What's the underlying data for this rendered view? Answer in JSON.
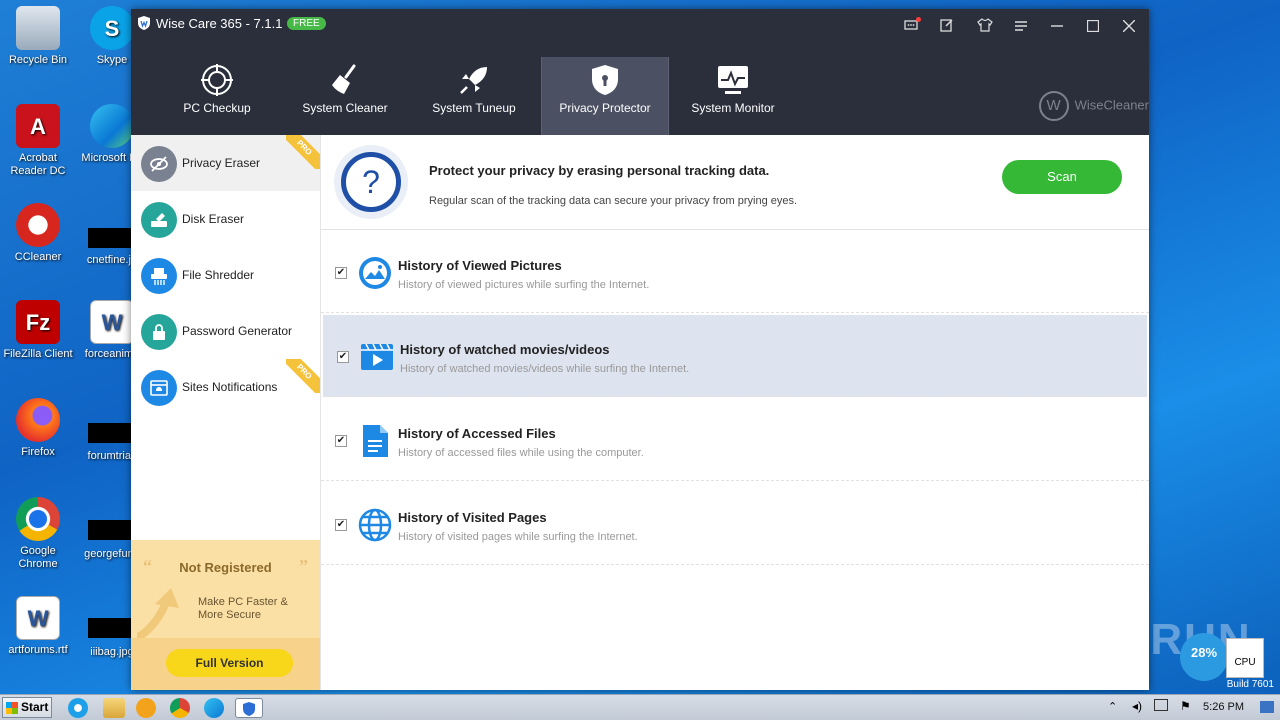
{
  "desktop": {
    "icons": [
      {
        "label": "Recycle Bin"
      },
      {
        "label": "Skype"
      },
      {
        "label": "Acrobat Reader DC"
      },
      {
        "label": "Microsoft Ed"
      },
      {
        "label": "CCleaner"
      },
      {
        "label": "cnetfine.jp"
      },
      {
        "label": "FileZilla Client"
      },
      {
        "label": "forceanima"
      },
      {
        "label": "Firefox"
      },
      {
        "label": "forumtrial."
      },
      {
        "label": "Google Chrome"
      },
      {
        "label": "georgefund"
      },
      {
        "label": "artforums.rtf"
      },
      {
        "label": "iiibag.jpg"
      }
    ]
  },
  "window": {
    "title": "Wise Care 365 - 7.1.1",
    "badge": "FREE",
    "brand": "WiseCleaner",
    "brand_mark": "W"
  },
  "nav": [
    {
      "label": "PC Checkup",
      "icon": "crosshair-icon"
    },
    {
      "label": "System Cleaner",
      "icon": "broom-icon"
    },
    {
      "label": "System Tuneup",
      "icon": "rocket-icon"
    },
    {
      "label": "Privacy Protector",
      "icon": "shield-lock-icon",
      "active": true
    },
    {
      "label": "System Monitor",
      "icon": "monitor-chart-icon"
    }
  ],
  "sidebar": {
    "items": [
      {
        "label": "Privacy Eraser",
        "pro": true,
        "active": true
      },
      {
        "label": "Disk Eraser"
      },
      {
        "label": "File Shredder"
      },
      {
        "label": "Password Generator"
      },
      {
        "label": "Sites Notifications",
        "pro": true
      }
    ],
    "pro_label": "PRO",
    "promo": {
      "title": "Not Registered",
      "subtitle": "Make PC Faster & More Secure",
      "button": "Full Version"
    }
  },
  "main": {
    "header_title": "Protect your privacy by erasing personal tracking data.",
    "header_subtitle": "Regular scan of the tracking data can secure your privacy from prying eyes.",
    "scan_button": "Scan",
    "rows": [
      {
        "title": "History of Viewed Pictures",
        "desc": "History of viewed pictures while surfing the Internet.",
        "checked": true
      },
      {
        "title": "History of watched movies/videos",
        "desc": "History of watched movies/videos while surfing the Internet.",
        "checked": true
      },
      {
        "title": "History of Accessed Files",
        "desc": "History of accessed files while using the computer.",
        "checked": true
      },
      {
        "title": "History of Visited Pages",
        "desc": "History of visited pages while surfing the Internet.",
        "checked": true
      }
    ]
  },
  "taskbar": {
    "start": "Start",
    "time": "5:26 PM",
    "build": "Build 7601",
    "cpu_label": "CPU",
    "cpu_percent": "28%"
  },
  "watermark": "ANY RUN",
  "colors": {
    "accent_green": "#35b836",
    "header_bg": "#2b2f3c",
    "icon_blue": "#1e88e5",
    "icon_teal": "#26a69a"
  }
}
